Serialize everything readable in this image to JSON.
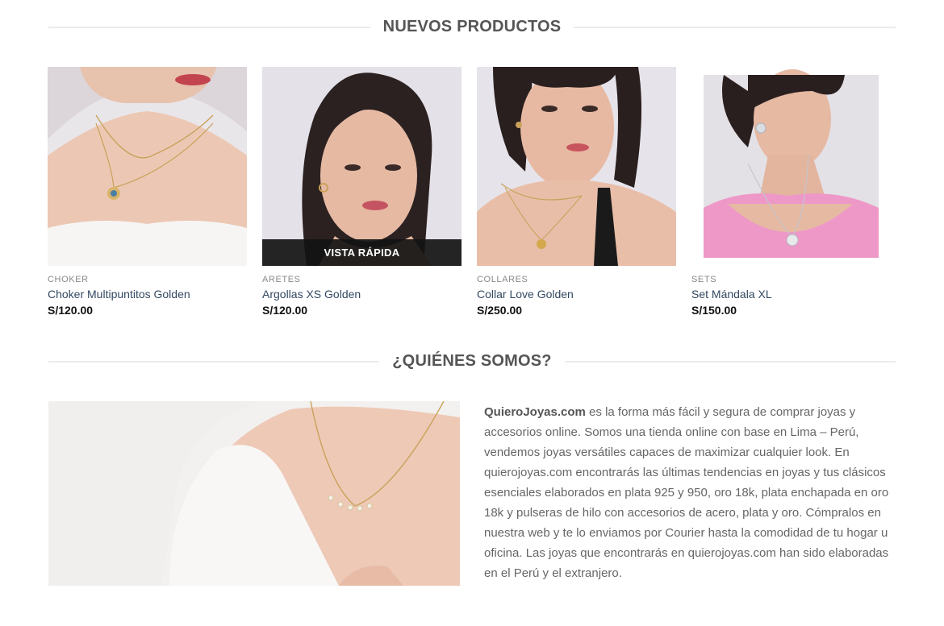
{
  "new_products": {
    "title": "NUEVOS PRODUCTOS",
    "quick_view_label": "VISTA RÁPIDA",
    "items": [
      {
        "category": "CHOKER",
        "name": "Choker Multipuntitos Golden",
        "price": "S/120.00"
      },
      {
        "category": "ARETES",
        "name": "Argollas XS Golden",
        "price": "S/120.00"
      },
      {
        "category": "COLLARES",
        "name": "Collar Love Golden",
        "price": "S/250.00"
      },
      {
        "category": "SETS",
        "name": "Set Mándala XL",
        "price": "S/150.00"
      }
    ]
  },
  "about": {
    "title": "¿QUIÉNES SOMOS?",
    "brand": "QuieroJoyas.com",
    "body": " es la forma más fácil y segura de comprar joyas y accesorios online. Somos una tienda online con base en Lima – Perú, vendemos joyas versátiles capaces de maximizar cualquier look. En quierojoyas.com encontrarás las últimas tendencias en joyas y tus clásicos esenciales elaborados en plata 925 y 950, oro 18k, plata enchapada en oro 18k y pulseras de hilo con accesorios de acero, plata y oro. Cómpralos en nuestra web y te lo enviamos por Courier hasta la comodidad de tu hogar u oficina. Las joyas que encontrarás en quierojoyas.com han sido elaboradas en el Perú y el extranjero."
  },
  "colors": {
    "product_name": "#334862",
    "price": "#111111",
    "title": "#555555",
    "divider": "#ececec"
  }
}
